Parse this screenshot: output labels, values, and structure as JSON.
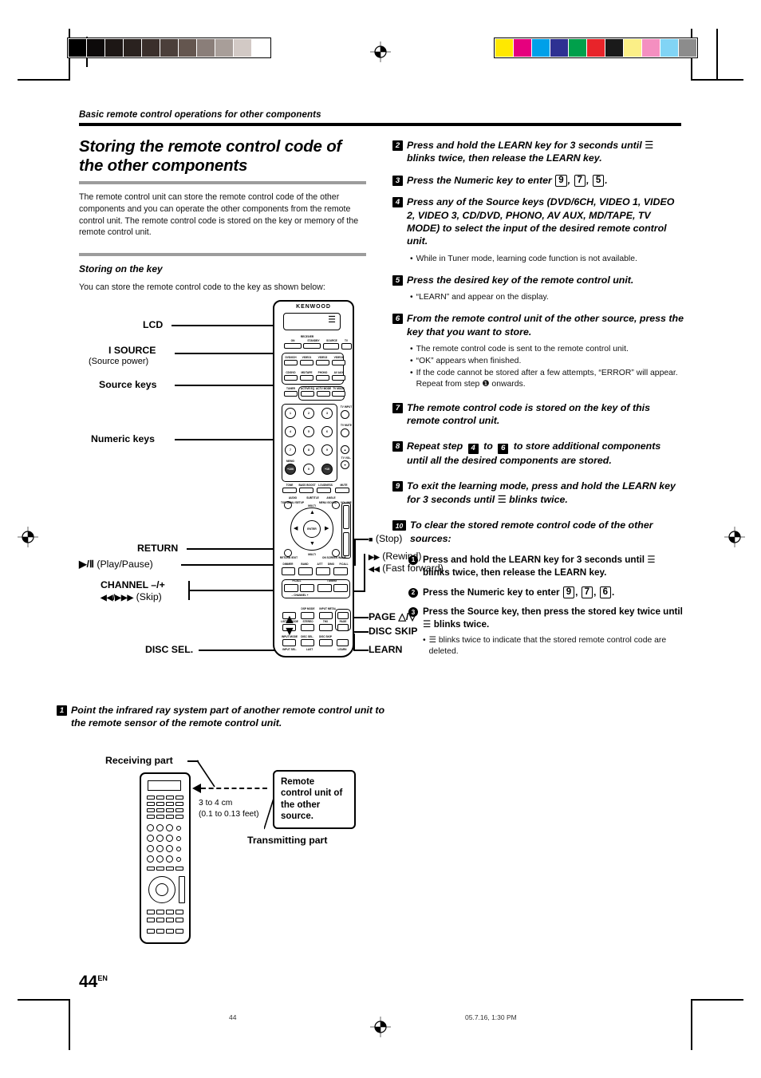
{
  "header": {
    "running_head": "Basic remote control operations for other components"
  },
  "left_column": {
    "section_title": "Storing the remote control code of the other components",
    "intro_paragraph": "The remote control unit can store the remote control code of the other components and you can operate the other components from the remote control unit. The remote control code is stored on the key or memory of the remote control unit.",
    "sub_title": "Storing on the key",
    "sub_intro": "You can store the remote control code to the key as shown below:"
  },
  "remote_figure": {
    "brand": "KENWOOD",
    "callouts": {
      "lcd": "LCD",
      "source": "SOURCE",
      "source_power": "(Source power)",
      "source_keys": "Source keys",
      "numeric_keys": "Numeric keys",
      "return": "RETURN",
      "play_pause": "(Play/Pause)",
      "play_pause_symbol": "▶/Ⅱ",
      "channel": "CHANNEL –/+",
      "skip_symbol": "◀◀/▶▶▶",
      "skip": "(Skip)",
      "disc_sel": "DISC SEL.",
      "stop": "(Stop)",
      "rewind": "(Rewind)",
      "fast_forward": "(Fast forward)",
      "page": "PAGE",
      "disc_skip": "DISC SKIP",
      "learn": "LEARN"
    },
    "keys": {
      "receiver_label": "RECEIVER",
      "receiver_on": "ON",
      "receiver_standby": "STANDBY",
      "source_power_key": "SOURCE",
      "tv_power_key": "TV",
      "source_row_1": [
        "DVD/6CH",
        "VIDEO1",
        "VIDEO2",
        "VIDEO3"
      ],
      "source_row_2": [
        "CD/DVD",
        "MD/TAPE",
        "PHONO",
        "AV AUX"
      ],
      "source_row_3": [
        "TUNER",
        "ACTIVE EQ",
        "ACTV MODE",
        "TV MODE"
      ],
      "numeric": [
        "1",
        "2",
        "3",
        "4",
        "5",
        "6",
        "7",
        "8",
        "9",
        "+100",
        "0",
        "+10"
      ],
      "numeric_memo": "MEMO",
      "tv_input": "TV INPUT",
      "tv_mute": "TV MUTE",
      "tv_vol": "TV VOL.",
      "fn_row_1": [
        "TONE",
        "BASS BOOST",
        "LOUDNESS",
        "MUTE"
      ],
      "fn_row_2": [
        "AUDIO",
        "SUBTITLE",
        "ANGLE"
      ],
      "top_menu": "TOP MENU /SETUP",
      "menu_sound": "MENU /SOUND",
      "volume": "VOLUME",
      "multi_up": "MULTI",
      "multi_down": "MULTI",
      "enter": "ENTER",
      "return_exit": "RETURN /EXIT",
      "on_screen": "ON SCREEN /NAME",
      "trans_row": [
        "DIMMER",
        "BAND",
        "A/TT",
        "DIMO",
        "P.CALL"
      ],
      "pcall_label": "P.CALL",
      "tuning_label": "TUNING",
      "channel_label": "– CHANNEL +",
      "dsp_mode": "DSP MODE",
      "input_metal": "INPUT METAL",
      "listen_mode": "LISTEN MODE",
      "stereo": "STEREO",
      "thx": "THX",
      "page_key": "PAGE",
      "input_mode": "INPUT MODE",
      "disc_sel_key": "DISC SEL.",
      "disc_skip_key": "DISC SKIP",
      "input_sel": "INPUT SEL.",
      "last": "LAST",
      "learn_key": "LEARN"
    }
  },
  "step_one": {
    "number": "1",
    "text": "Point the infrared ray system part of another remote control unit to the remote sensor of the remote control unit."
  },
  "bottom_figure": {
    "receiving_part": "Receiving part",
    "transmitting_part": "Transmitting part",
    "distance_cm": "3 to 4 cm",
    "distance_feet": "(0.1 to 0.13 feet)",
    "bubble": "Remote control unit of the other source."
  },
  "right_column": {
    "steps": [
      {
        "number": "2",
        "text_before": "Press and hold the LEARN key for 3 seconds until",
        "icon": "wifi-signal-icon",
        "text_after": "blinks twice, then release the LEARN key."
      },
      {
        "number": "3",
        "text_before": "Press the Numeric key to enter",
        "keys": [
          "9",
          "7",
          "5"
        ]
      },
      {
        "number": "4",
        "text": "Press any of the Source keys (DVD/6CH, VIDEO 1, VIDEO 2, VIDEO 3, CD/DVD, PHONO, AV AUX, MD/TAPE, TV MODE) to select the input of the desired remote control unit.",
        "notes": [
          "While in Tuner mode, learning code function is not available."
        ]
      },
      {
        "number": "5",
        "text": "Press the desired key of the remote control unit.",
        "notes": [
          "“LEARN” and  appear on the display."
        ]
      },
      {
        "number": "6",
        "text": "From the remote control unit of the other source, press the key that you want to store.",
        "notes": [
          "The remote control code is sent to the remote control unit.",
          "“OK” appears when finished.",
          "If the code cannot be stored after a few attempts, “ERROR” will appear. Repeat from step ❶ onwards."
        ]
      },
      {
        "number": "7",
        "text": "The remote control code is stored on the key of this remote control unit."
      },
      {
        "number": "8",
        "text_parts": [
          "Repeat step",
          "to",
          "to store additional components until all the desired components are stored."
        ],
        "ref_from": "4",
        "ref_to": "6"
      },
      {
        "number": "9",
        "text_before": "To exit the learning mode, press and hold the LEARN key  for 3 seconds until",
        "text_after": "blinks twice."
      },
      {
        "number": "10",
        "text": "To clear the stored remote control code of the other sources:"
      }
    ],
    "clear_sub_steps": [
      {
        "number": "1",
        "text_before": "Press and hold the LEARN key for 3 seconds until",
        "text_after": "blinks twice, then release the LEARN key."
      },
      {
        "number": "2",
        "text_before": "Press the Numeric key to enter",
        "keys": [
          "9",
          "7",
          "6"
        ]
      },
      {
        "number": "3",
        "text_before": "Press the Source key, then press the stored key twice until",
        "text_after": "blinks twice."
      }
    ],
    "clear_note_before": "",
    "clear_note_after": "blinks twice to indicate that the stored remote control code are deleted."
  },
  "footer": {
    "page_number": "44",
    "page_lang": "EN",
    "footer_page": "44",
    "timestamp": "05.7.16, 1:30 PM"
  },
  "print_marks": {
    "grayscale_bar": [
      "#000000",
      "#0d0a0a",
      "#1d1715",
      "#2a221f",
      "#3a2f2b",
      "#4b3f3a",
      "#64564f",
      "#8a7e79",
      "#a89e99",
      "#d2c9c5",
      "#ffffff"
    ],
    "color_bar": [
      "#ffe800",
      "#e6007e",
      "#00a0e9",
      "#2e3192",
      "#00a04b",
      "#e8242a",
      "#1a1a1a",
      "#fbef87",
      "#f48fc0",
      "#81d4f5",
      "#8c8c8c"
    ]
  }
}
